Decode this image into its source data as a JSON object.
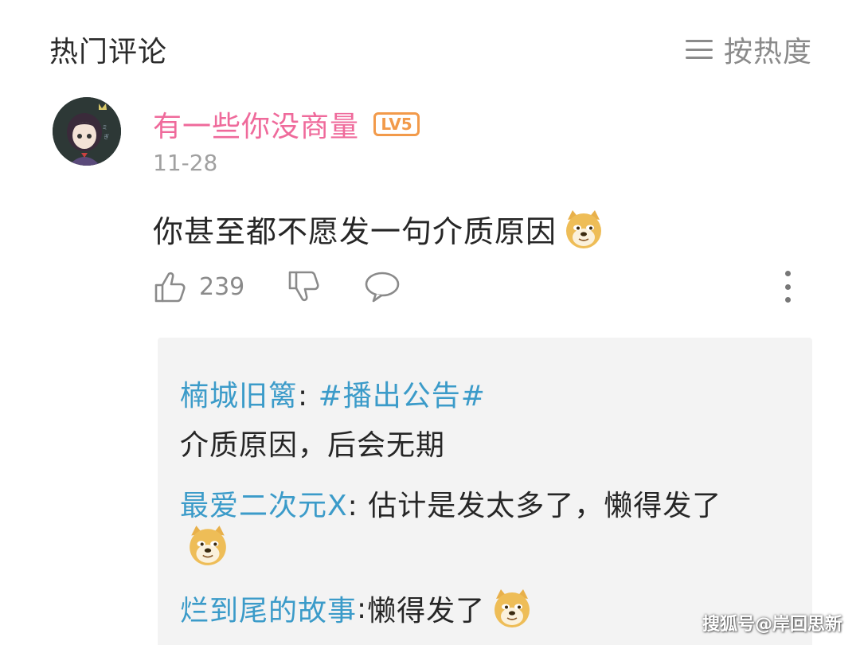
{
  "header": {
    "title": "热门评论",
    "sort_label": "按热度"
  },
  "comment": {
    "username": "有一些你没商量",
    "level": "LV5",
    "date": "11-28",
    "text": "你甚至都不愿发一句介质原因",
    "like_count": "239"
  },
  "replies": [
    {
      "name": "楠城旧篱",
      "sep": ": ",
      "topic": "#播出公告#",
      "text": "介质原因，后会无期"
    },
    {
      "name": "最爱二次元X",
      "sep": ": ",
      "text": "估计是发太多了，懒得发了"
    },
    {
      "name": "烂到尾的故事",
      "sep": ": ",
      "text": "懒得发了"
    }
  ],
  "watermark": "搜狐号@岸回思新",
  "colors": {
    "username": "#ef6a9b",
    "level_badge": "#f29a4a",
    "reply_name": "#3b9bc9",
    "reply_bg": "#f3f3f3"
  },
  "icons": [
    "menu-icon",
    "avatar",
    "doge-emoji",
    "thumbs-up-icon",
    "thumbs-down-icon",
    "chat-bubble-icon",
    "more-vertical-icon"
  ]
}
